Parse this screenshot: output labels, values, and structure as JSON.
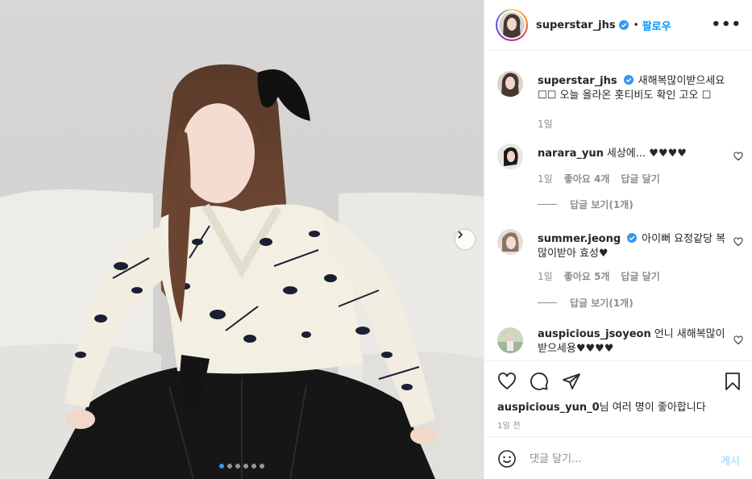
{
  "post": {
    "author": "superstar_jhs",
    "follow_label": "팔로우",
    "separator": "•",
    "more_label": "•••",
    "caption": "새해복많이받으세요 ☐☐ 오늘 올라온 홋티비도 확인 고오 ☐",
    "caption_age": "1일"
  },
  "comments": [
    {
      "username": "narara_yun",
      "verified": false,
      "text": "세상에... ♥♥♥♥",
      "age": "1일",
      "likes": "좋아요 4개",
      "reply_label": "답글 달기",
      "view_replies": "답글 보기(1개)"
    },
    {
      "username": "summer.jeong",
      "verified": true,
      "text": "아이뻐 요정같당 복 많이받아 효성♥",
      "age": "1일",
      "likes": "좋아요 5개",
      "reply_label": "답글 달기",
      "view_replies": "답글 보기(1개)"
    },
    {
      "username": "auspicious_jsoyeon",
      "verified": false,
      "text": "언니 새해복많이 받으세용♥♥♥♥"
    }
  ],
  "likes_line": {
    "user": "auspicious_yun_0",
    "suffix": "님 여러 명",
    "suffix2": "이 좋아합니다"
  },
  "timestamp": "1일 전",
  "add_comment": {
    "placeholder": "댓글 달기...",
    "post_label": "게시"
  },
  "carousel": {
    "count": 6,
    "active_index": 0
  },
  "colors": {
    "accent": "#0095f6",
    "verified": "#3897f0",
    "muted": "#8e8e8e",
    "text": "#262626"
  },
  "icons": [
    "verified-icon",
    "more-icon",
    "heart-icon",
    "comment-icon",
    "share-icon",
    "bookmark-icon",
    "emoji-icon",
    "chevron-right-icon"
  ]
}
